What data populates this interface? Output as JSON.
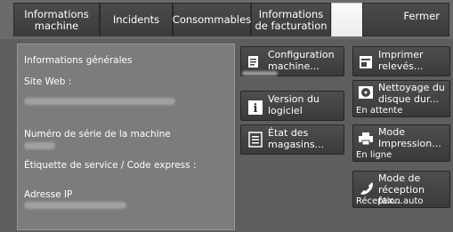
{
  "tabs": [
    {
      "label": "Informations machine",
      "active": false
    },
    {
      "label": "Incidents",
      "active": false
    },
    {
      "label": "Consommables",
      "active": false
    },
    {
      "label": "Informations de facturation",
      "active": false
    },
    {
      "label": "",
      "active": true
    }
  ],
  "close_label": "Fermer",
  "info": {
    "general": "Informations générales",
    "website_label": "Site Web :",
    "serial_label": "Numéro de série de la machine",
    "service_label": "Étiquette de service / Code express :",
    "ip_label": "Adresse IP"
  },
  "buttons": {
    "configuration": "Configuration machine...",
    "version": "Version du logiciel",
    "trays": "État des magasins...",
    "print_reports": "Imprimer relevés...",
    "cleaning": "Nettoyage du disque dur...",
    "cleaning_status": "En attente",
    "print_mode": "Mode Impression...",
    "print_mode_status": "En ligne",
    "fax_mode": "Mode de réception fax...",
    "fax_mode_status": "Réception auto"
  },
  "colors": {
    "background": "#5e5e5e",
    "panel": "#7c7c7c",
    "button": "#444444",
    "active_tab": "#f5f5f5"
  }
}
